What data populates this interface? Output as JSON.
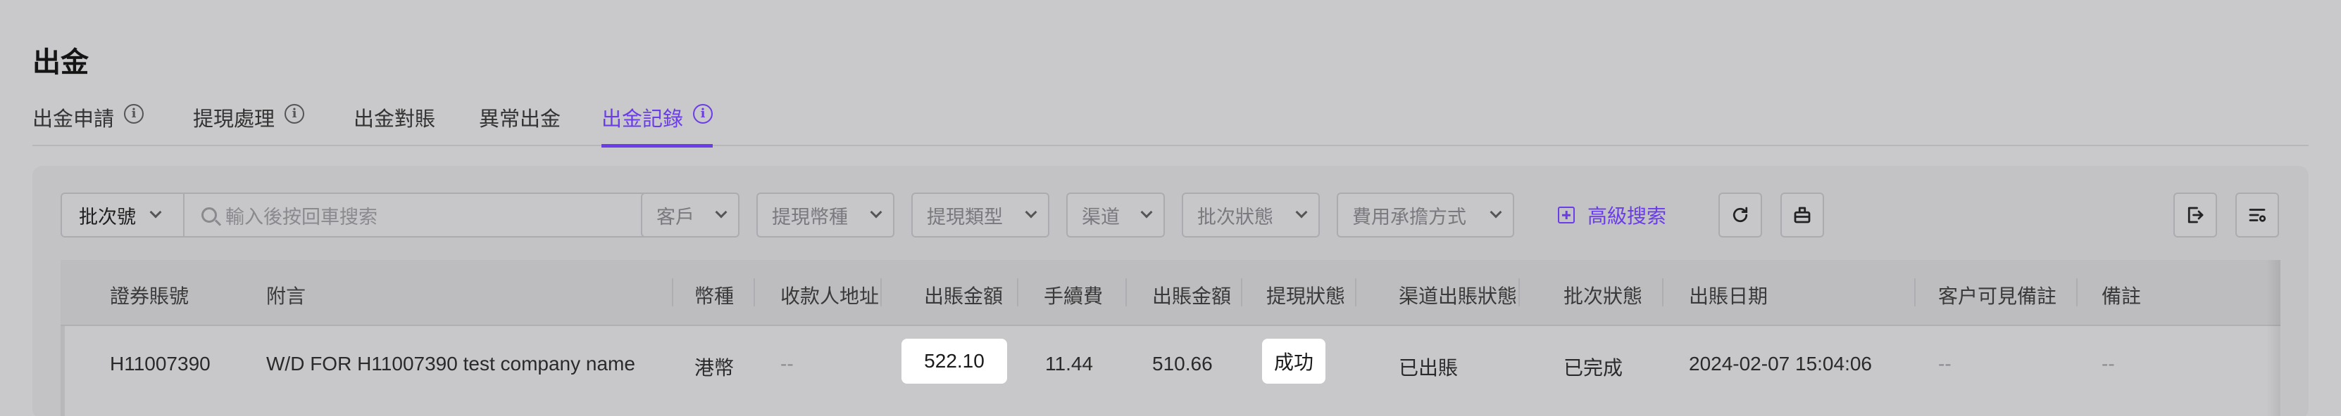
{
  "page": {
    "title": "出金"
  },
  "tabs": [
    {
      "label": "出金申請",
      "info": true,
      "active": false
    },
    {
      "label": "提現處理",
      "info": true,
      "active": false
    },
    {
      "label": "出金對賬",
      "info": false,
      "active": false
    },
    {
      "label": "異常出金",
      "info": false,
      "active": false
    },
    {
      "label": "出金記錄",
      "info": true,
      "active": true
    }
  ],
  "filters": {
    "batch_select": "批次號",
    "search_placeholder": "輸入後按回車搜索",
    "customer": "客戶",
    "currency": "提現幣種",
    "type": "提現類型",
    "channel": "渠道",
    "batch_status": "批次狀態",
    "fee_bearer": "費用承擔方式",
    "advanced_search": "高級搜索"
  },
  "table": {
    "headers": {
      "account": "證券賬號",
      "memo": "附言",
      "currency": "幣種",
      "payee_address": "收款人地址",
      "out_amount": "出賬金額",
      "fee": "手續費",
      "net_amount": "出賬金額",
      "status": "提現狀態",
      "channel_status": "渠道出賬狀態",
      "batch_status": "批次狀態",
      "date": "出賬日期",
      "customer_note": "客户可見備註",
      "remark": "備註"
    },
    "rows": [
      {
        "account": "H11007390",
        "memo": "W/D FOR H11007390 test company name",
        "currency": "港幣",
        "payee_address": "--",
        "out_amount": "522.10",
        "fee": "11.44",
        "net_amount": "510.66",
        "status": "成功",
        "channel_status": "已出賬",
        "batch_status": "已完成",
        "date": "2024-02-07 15:04:06",
        "customer_note": "--",
        "remark": "--"
      }
    ]
  },
  "colors": {
    "accent": "#6a3de8",
    "background": "#c9c9cb"
  }
}
